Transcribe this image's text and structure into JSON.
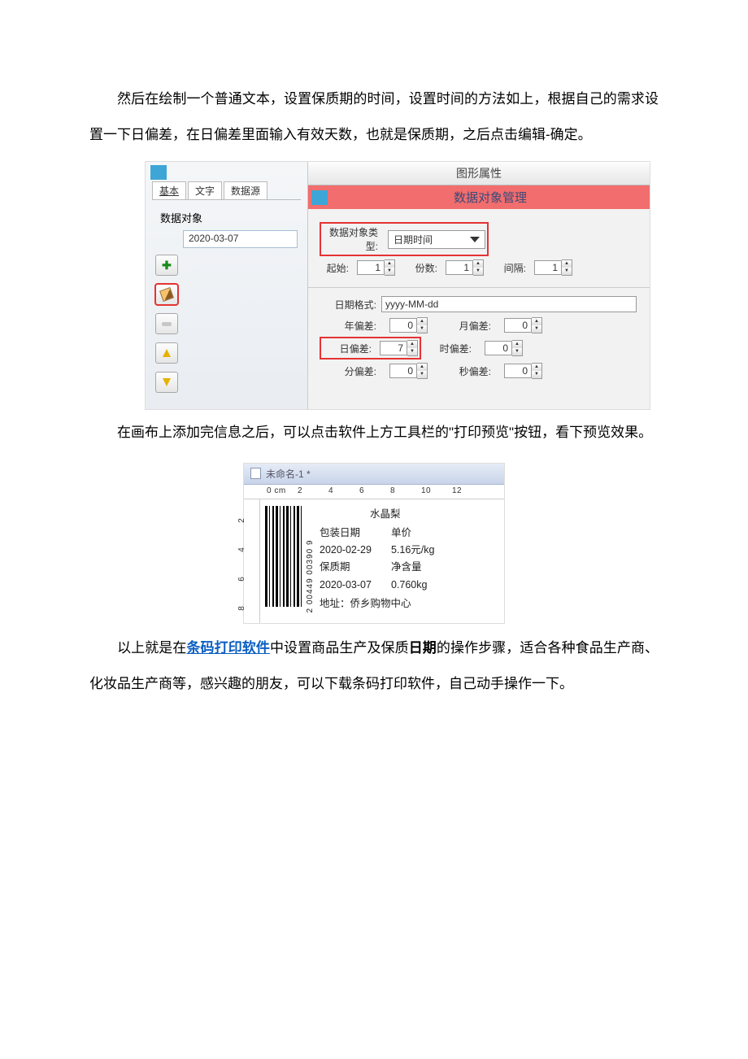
{
  "paragraph1": {
    "text_a": "然后在绘制一个普通文本，设置保质期的时间，设置时间的方法如上，根据自己的需求设置一下日偏差，在日偏差里面输入有效天数，也就是保质期，之后点击编辑-确定。"
  },
  "properties_dialog": {
    "title": "图形属性",
    "object_manager_title": "数据对象管理",
    "tabs": [
      "基本",
      "文字",
      "数据源"
    ],
    "data_object_label": "数据对象",
    "data_object_value": "2020-03-07",
    "buttons": {
      "add": "plus-icon",
      "edit": "pencil-icon",
      "remove": "minus-icon",
      "up": "arrow-up-icon",
      "down": "arrow-down-icon"
    },
    "type_row": {
      "label": "数据对象类型:",
      "value": "日期时间"
    },
    "start_label": "起始:",
    "start_value": "1",
    "count_label": "份数:",
    "count_value": "1",
    "interval_label": "间隔:",
    "interval_value": "1",
    "date_format_label": "日期格式:",
    "date_format_value": "yyyy-MM-dd",
    "offsets": {
      "year": {
        "label": "年偏差:",
        "value": "0"
      },
      "month": {
        "label": "月偏差:",
        "value": "0"
      },
      "day": {
        "label": "日偏差:",
        "value": "7"
      },
      "hour": {
        "label": "时偏差:",
        "value": "0"
      },
      "minute": {
        "label": "分偏差:",
        "value": "0"
      },
      "second": {
        "label": "秒偏差:",
        "value": "0"
      }
    }
  },
  "paragraph2": "在画布上添加完信息之后，可以点击软件上方工具栏的\"打印预览\"按钮，看下预览效果。",
  "preview_window": {
    "title": "未命名-1 *",
    "ruler_h": [
      "0 cm",
      "2",
      "4",
      "6",
      "8",
      "10",
      "12"
    ],
    "ruler_v": [
      "2",
      "4",
      "6",
      "8"
    ],
    "barcode_text": "2 00449 00390 9",
    "product_name": "水晶梨",
    "left_col": {
      "pack_date_label": "包装日期",
      "pack_date_value": "2020-02-29",
      "shelf_life_label": "保质期",
      "shelf_life_value": "2020-03-07"
    },
    "right_col": {
      "price_label": "单价",
      "price_value": "5.16元/kg",
      "weight_label": "净含量",
      "weight_value": "0.760kg"
    },
    "address": "地址：侨乡购物中心"
  },
  "paragraph3": {
    "pre": "以上就是在",
    "link": "条码打印软件",
    "mid": "中设置商品生产及保质",
    "bold": "日期",
    "post": "的操作步骤，适合各种食品生产商、化妆品生产商等，感兴趣的朋友，可以下载条码打印软件，自己动手操作一下。"
  }
}
